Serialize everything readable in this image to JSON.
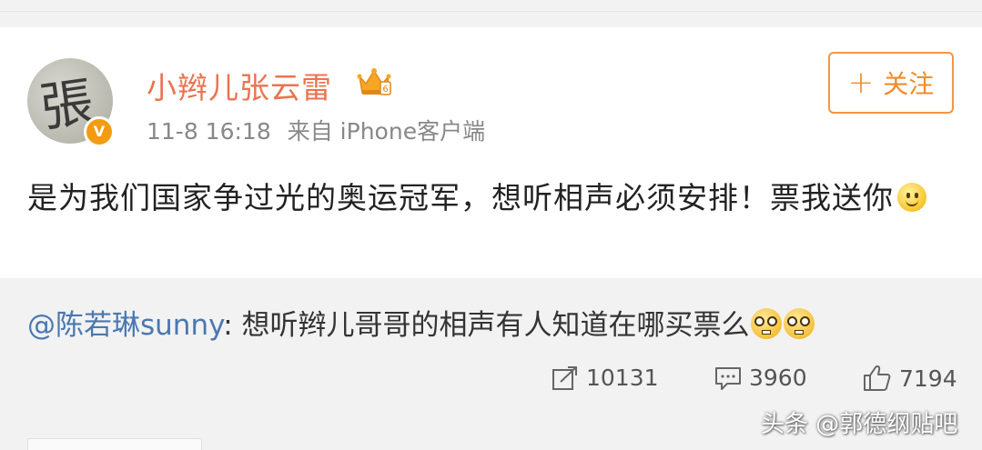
{
  "post": {
    "username": "小辫儿张云雷",
    "timestamp": "11-8 16:18",
    "source": "来自 iPhone客户端",
    "avatar_char": "張",
    "verified_badge": "V",
    "follow_label": "关注",
    "text": "是为我们国家争过光的奥运冠军，想听相声必须安排！票我送你",
    "text_emoji": "smile-emoji"
  },
  "repost": {
    "mention": "@陈若琳sunny",
    "text": ": 想听辫儿哥哥的相声有人知道在哪买票么",
    "emojis": [
      "nerd-emoji",
      "nerd-emoji"
    ]
  },
  "stats": {
    "reposts": "10131",
    "comments": "3960",
    "likes": "7194"
  },
  "watermark": "头条 @郭德纲贴吧",
  "colors": {
    "username": "#eb7350",
    "follow_border": "#f29646",
    "mention": "#4a78b0",
    "repost_bg": "#f2f2f2"
  }
}
